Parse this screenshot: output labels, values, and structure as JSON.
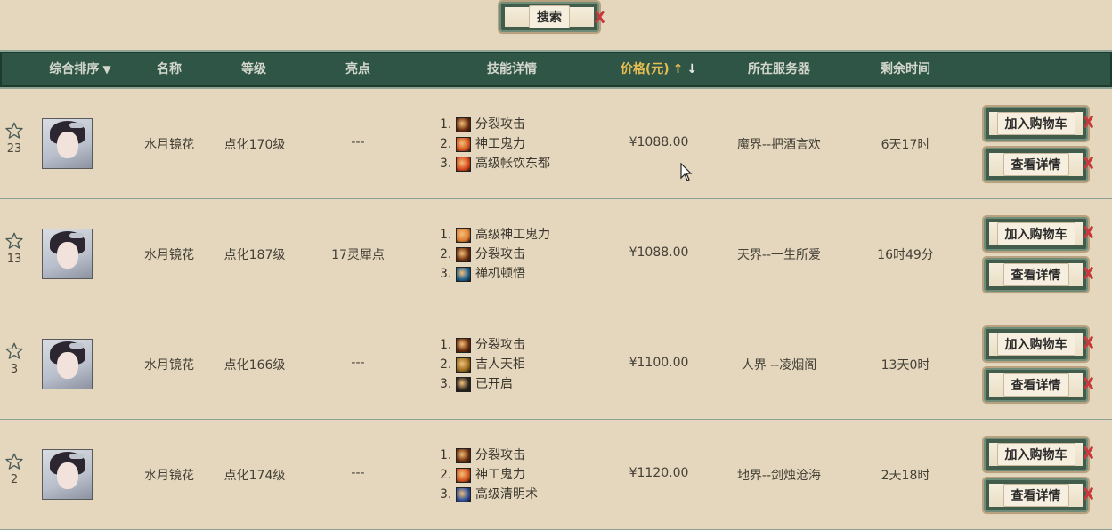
{
  "search": {
    "label": "搜索"
  },
  "header": {
    "sort_label": "综合排序",
    "name": "名称",
    "level": "等级",
    "highlight": "亮点",
    "skills": "技能详情",
    "price": "价格(元)",
    "server": "所在服务器",
    "remaining": "剩余时间"
  },
  "buttons": {
    "add_to_cart": "加入购物车",
    "view_details": "查看详情"
  },
  "colors": {
    "header_bg": "#2f5546",
    "price_sort": "#e6bd52",
    "page_bg": "#e4d7bd"
  },
  "rows": [
    {
      "favorites": "23",
      "name": "水月镜花",
      "level": "点化170级",
      "highlight": "---",
      "skills": [
        {
          "num": "1.",
          "name": "分裂攻击",
          "icon": "split-attack-icon",
          "color": "#6b2b0b"
        },
        {
          "num": "2.",
          "name": "神工鬼力",
          "icon": "divine-craft-icon",
          "color": "#d3521c"
        },
        {
          "num": "3.",
          "name": "高级帐饮东都",
          "icon": "feast-icon",
          "color": "#d8461b"
        }
      ],
      "price": "¥1088.00",
      "server": "魔界--把酒言欢",
      "remaining": "6天17时"
    },
    {
      "favorites": "13",
      "name": "水月镜花",
      "level": "点化187级",
      "highlight": "17灵犀点",
      "skills": [
        {
          "num": "1.",
          "name": "高级神工鬼力",
          "icon": "divine-craft-icon",
          "color": "#e07d30"
        },
        {
          "num": "2.",
          "name": "分裂攻击",
          "icon": "split-attack-icon",
          "color": "#6b2b0b"
        },
        {
          "num": "3.",
          "name": "禅机顿悟",
          "icon": "zen-icon",
          "color": "#1b5f8f"
        }
      ],
      "price": "¥1088.00",
      "server": "天界--一生所爱",
      "remaining": "16时49分"
    },
    {
      "favorites": "3",
      "name": "水月镜花",
      "level": "点化166级",
      "highlight": "---",
      "skills": [
        {
          "num": "1.",
          "name": "分裂攻击",
          "icon": "split-attack-icon",
          "color": "#6b2b0b"
        },
        {
          "num": "2.",
          "name": "吉人天相",
          "icon": "fortune-icon",
          "color": "#9b6d1c"
        },
        {
          "num": "3.",
          "name": "已开启",
          "icon": "opened-icon",
          "color": "#2a2620"
        }
      ],
      "price": "¥1100.00",
      "server": "人界 --凌烟阁",
      "remaining": "13天0时"
    },
    {
      "favorites": "2",
      "name": "水月镜花",
      "level": "点化174级",
      "highlight": "---",
      "skills": [
        {
          "num": "1.",
          "name": "分裂攻击",
          "icon": "split-attack-icon",
          "color": "#6b2b0b"
        },
        {
          "num": "2.",
          "name": "神工鬼力",
          "icon": "divine-craft-icon",
          "color": "#d3521c"
        },
        {
          "num": "3.",
          "name": "高级清明术",
          "icon": "clarity-icon",
          "color": "#2c4f9c"
        }
      ],
      "price": "¥1120.00",
      "server": "地界--剑烛沧海",
      "remaining": "2天18时"
    }
  ]
}
